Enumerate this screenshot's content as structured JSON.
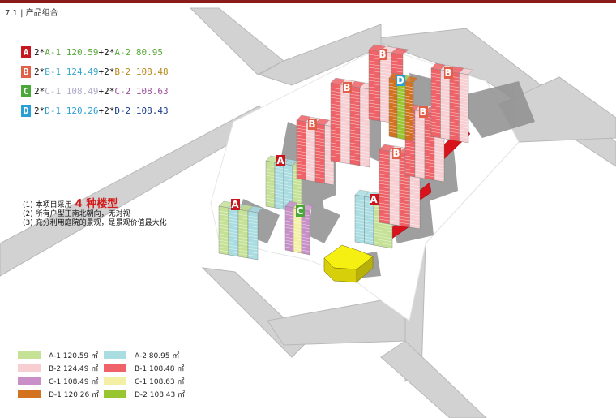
{
  "header": {
    "section": "7.1 | 产品组合"
  },
  "type_list": [
    {
      "badge": "A",
      "badge_color": "#c8161e",
      "unit1": "A-1 120.59",
      "unit1_color": "#5aa83b",
      "unit2": "A-2 80.95",
      "unit2_color": "#5aa83b"
    },
    {
      "badge": "B",
      "badge_color": "#e0604a",
      "unit1": "B-1 124.49",
      "unit1_color": "#37a9c8",
      "unit2": "B-2 108.48",
      "unit2_color": "#b88a1c"
    },
    {
      "badge": "C",
      "badge_color": "#4aa83a",
      "unit1": "C-1 108.49",
      "unit1_color": "#b0a8c8",
      "unit2": "C-2 108.63",
      "unit2_color": "#9a4f9a"
    },
    {
      "badge": "D",
      "badge_color": "#2a9fd6",
      "unit1": "D-1 120.26",
      "unit1_color": "#2a9fd6",
      "unit2": "D-2 108.43",
      "unit2_color": "#1a3d8c"
    }
  ],
  "prefix": "2*",
  "joiner": "+2*",
  "notes": [
    {
      "text": "(1) 本项目采用",
      "emphasis": "4 种楼型"
    },
    {
      "text": "(2) 所有户型正南北朝向，无对视"
    },
    {
      "text": "(3) 充分利用庭院的景观，是景观价值最大化"
    }
  ],
  "legend": [
    {
      "label": "A-1 120.59 ㎡",
      "color": "#c4e196"
    },
    {
      "label": "A-2 80.95 ㎡",
      "color": "#a9dde2"
    },
    {
      "label": "B-2 124.49 ㎡",
      "color": "#f7cfd2"
    },
    {
      "label": "B-1 108.48 ㎡",
      "color": "#ef6268"
    },
    {
      "label": "C-1 108.49 ㎡",
      "color": "#c98fc9"
    },
    {
      "label": "C-1 108.63 ㎡",
      "color": "#f3f0a6"
    },
    {
      "label": "D-1 120.26 ㎡",
      "color": "#d3731f"
    },
    {
      "label": "D-2 108.43 ㎡",
      "color": "#99c530"
    }
  ],
  "buildings": [
    "A",
    "A",
    "A",
    "A",
    "B",
    "B",
    "B",
    "B",
    "B",
    "B",
    "B",
    "C",
    "D"
  ],
  "colors": {
    "road": "#d2d2d2",
    "road_edge": "#b8b8b8",
    "site": "#ffffff",
    "shadow": "#8f8f8f",
    "podium_red": "#d8131b",
    "clubhouse": "#f5ef12"
  }
}
